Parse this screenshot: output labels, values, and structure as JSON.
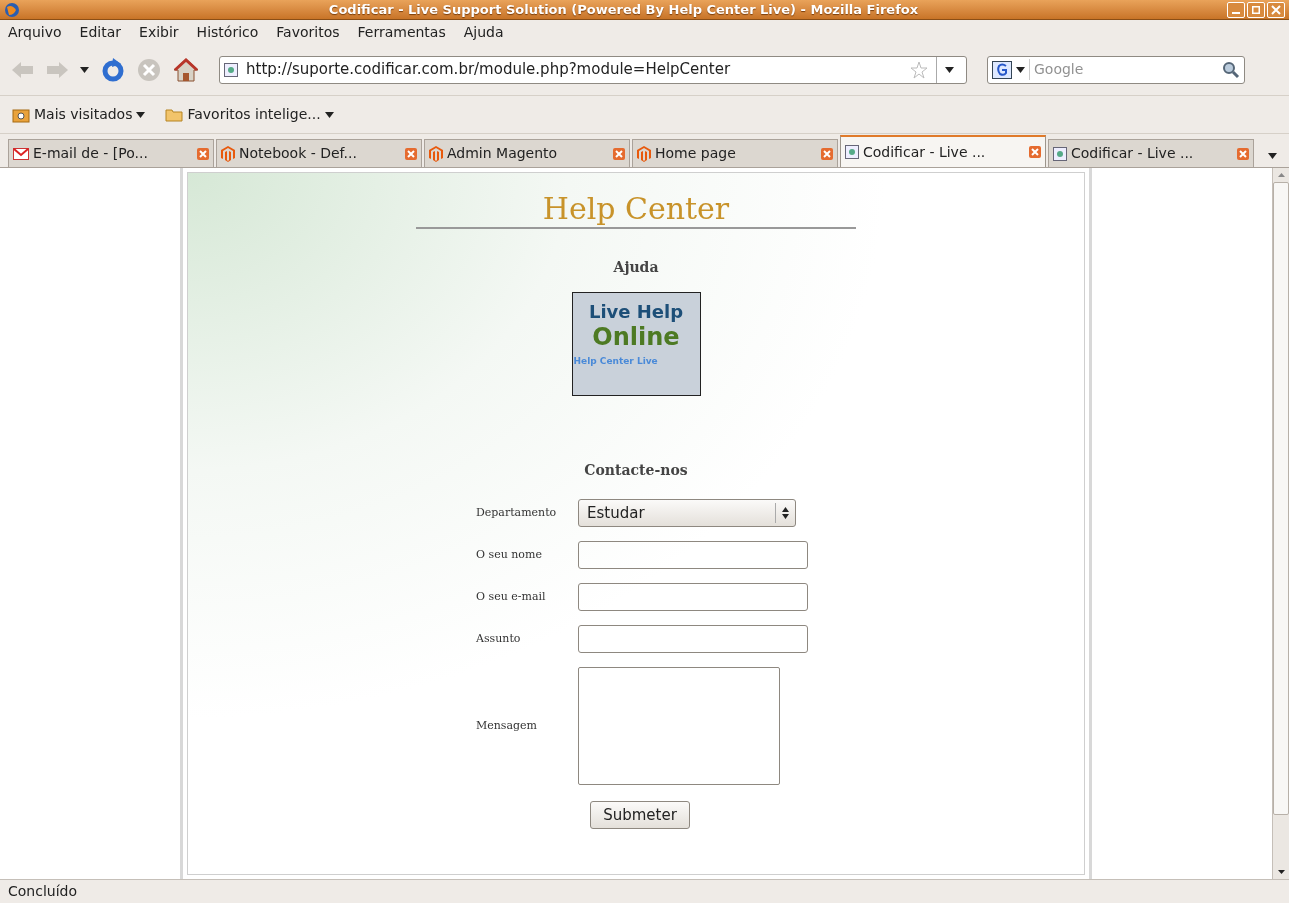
{
  "window": {
    "title": "Codificar - Live Support Solution (Powered By Help Center Live) - Mozilla Firefox"
  },
  "menu": [
    "Arquivo",
    "Editar",
    "Exibir",
    "Histórico",
    "Favoritos",
    "Ferramentas",
    "Ajuda"
  ],
  "address_bar": {
    "value": "http://suporte.codificar.com.br/module.php?module=HelpCenter"
  },
  "search": {
    "placeholder": "Google"
  },
  "bookmarks": [
    {
      "label": "Mais visitados",
      "kind": "smart"
    },
    {
      "label": "Favoritos intelige...",
      "kind": "folder"
    }
  ],
  "tabs": [
    {
      "label": "E-mail de  - [Po...",
      "kind": "mail",
      "selected": false
    },
    {
      "label": "Notebook - Def...",
      "kind": "magento",
      "selected": false
    },
    {
      "label": "Admin Magento",
      "kind": "magento",
      "selected": false
    },
    {
      "label": "Home page",
      "kind": "magento",
      "selected": false
    },
    {
      "label": "Codificar - Live ...",
      "kind": "page",
      "selected": true
    },
    {
      "label": "Codificar - Live ...",
      "kind": "page",
      "selected": false
    }
  ],
  "page": {
    "heading": "Help Center",
    "section": "Ajuda",
    "logo": {
      "line1": "Live Help",
      "line2": "Online",
      "line3": "Help Center Live"
    },
    "form_title": "Contacte-nos",
    "fields": [
      {
        "label": "Departamento",
        "kind": "select",
        "value": "Estudar"
      },
      {
        "label": "O seu nome",
        "kind": "text"
      },
      {
        "label": "O seu e-mail",
        "kind": "text"
      },
      {
        "label": "Assunto",
        "kind": "text"
      },
      {
        "label": "Mensagem",
        "kind": "textarea"
      }
    ],
    "submit": "Submeter"
  },
  "status_bar": "Concluído"
}
